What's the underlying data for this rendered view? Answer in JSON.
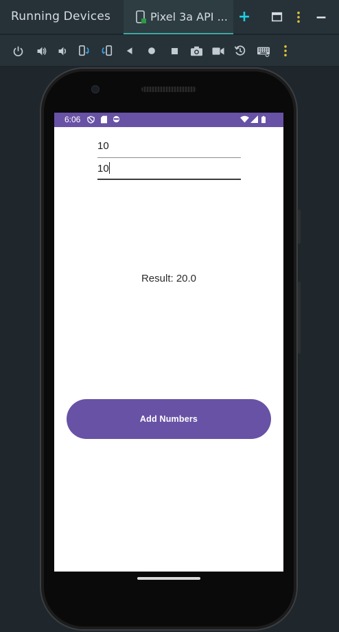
{
  "ide": {
    "panel_title": "Running Devices",
    "device_tab_label": "Pixel 3a API ...",
    "add_tab_symbol": "+",
    "icons": [
      "device-tab-icon",
      "new-tab-plus-icon",
      "window-layout-icon",
      "options-vertical-dots-icon",
      "minimize-icon"
    ],
    "toolbar_icons": [
      "power-icon",
      "volume-up-icon",
      "volume-down-icon",
      "rotate-left-icon",
      "rotate-right-icon",
      "back-icon",
      "home-icon",
      "overview-icon",
      "screenshot-camera-icon",
      "screen-record-icon",
      "snapshot-reset-icon",
      "keyboard-icon",
      "more-vertical-icon"
    ],
    "accent_color": "#1dcfe6",
    "active_tab_underline": "#3fa9a2"
  },
  "device": {
    "status_bar": {
      "time": "6:06",
      "color": "#6852a5",
      "left_icons": [
        "shield-icon",
        "sd-card-icon",
        "settings-face-icon"
      ],
      "right_icons": [
        "wifi-icon",
        "signal-icon",
        "battery-icon"
      ]
    },
    "app": {
      "field1_value": "10",
      "field2_value": "10",
      "result_text": "Result: 20.0",
      "button_label": "Add Numbers",
      "button_color": "#6852a5"
    }
  }
}
